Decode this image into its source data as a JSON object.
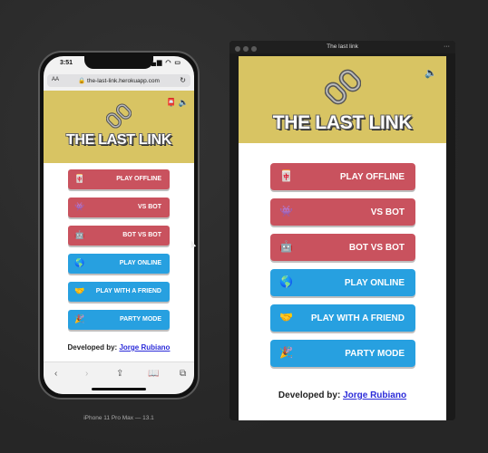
{
  "phone": {
    "status_time": "3:51",
    "status_icons": "▂▄▆ ◠ ▭",
    "url_aa": "AA",
    "url": "🔒 the-last-link.herokuapp.com",
    "reload_icon": "↻",
    "top_icons": "📮 🔈",
    "logo_icon": "🔗",
    "title": "THE LAST LINK",
    "buttons": [
      {
        "emoji": "🀄",
        "label": "PLAY OFFLINE",
        "color": "red"
      },
      {
        "emoji": "👾",
        "label": "VS BOT",
        "color": "red"
      },
      {
        "emoji": "🤖",
        "label": "BOT VS BOT",
        "color": "red"
      },
      {
        "emoji": "🌎",
        "label": "PLAY ONLINE",
        "color": "blue"
      },
      {
        "emoji": "🤝",
        "label": "PLAY WITH A FRIEND",
        "color": "blue"
      },
      {
        "emoji": "🎉",
        "label": "PARTY MODE",
        "color": "blue"
      }
    ],
    "footer_prefix": "Developed by: ",
    "footer_link": "Jorge Rubiano",
    "toolbar": {
      "back": "‹",
      "forward": "›",
      "share": "⇪",
      "bookmarks": "📖",
      "tabs": "⧉"
    },
    "caption": "iPhone 11 Pro Max — 13.1"
  },
  "window": {
    "title": "The last link",
    "more": "···",
    "speaker_icon": "🔈",
    "logo_icon": "🔗",
    "app_title": "THE LAST LINK",
    "buttons": [
      {
        "emoji": "🀄",
        "label": "PLAY OFFLINE",
        "color": "red"
      },
      {
        "emoji": "👾",
        "label": "VS BOT",
        "color": "red"
      },
      {
        "emoji": "🤖",
        "label": "BOT VS BOT",
        "color": "red"
      },
      {
        "emoji": "🌎",
        "label": "PLAY ONLINE",
        "color": "blue"
      },
      {
        "emoji": "🤝",
        "label": "PLAY WITH A FRIEND",
        "color": "blue"
      },
      {
        "emoji": "🎉",
        "label": "PARTY MODE",
        "color": "blue"
      }
    ],
    "footer_prefix": "Developed by: ",
    "footer_link": "Jorge Rubiano"
  },
  "colors": {
    "header": "#d8c463",
    "red": "#c9525e",
    "blue": "#27a0e0",
    "link": "#2b2bd9"
  }
}
